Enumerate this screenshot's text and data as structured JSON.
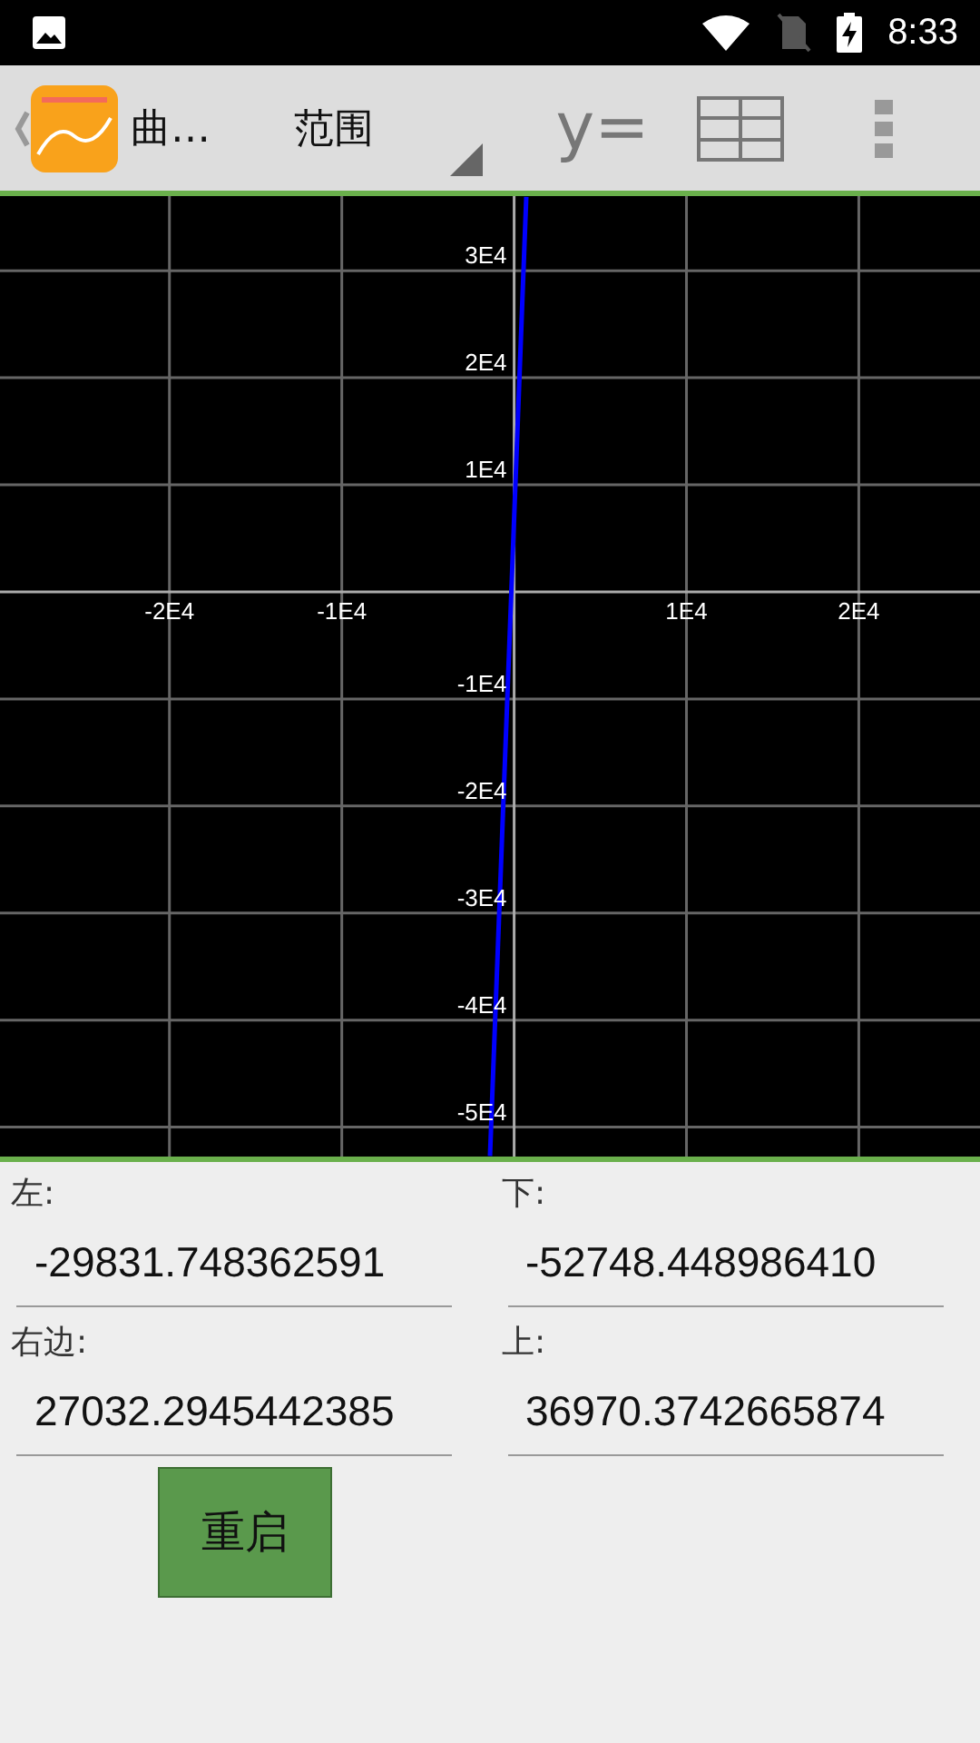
{
  "status_bar": {
    "time": "8:33"
  },
  "toolbar": {
    "title": "曲…",
    "spinner": {
      "label": "范围"
    },
    "equation_action": {
      "label": "y="
    }
  },
  "graph": {
    "chart_data": {
      "type": "line",
      "x": [
        -1400,
        706
      ],
      "grid": true,
      "series": [
        {
          "color": "#0000ff",
          "values": [
            -52700,
            36900
          ]
        }
      ],
      "xlim": [
        -29831.748,
        27032.294
      ],
      "ylim": [
        -52748.449,
        36970.374
      ],
      "xticks": [
        {
          "value": -20000,
          "label": "-2E4"
        },
        {
          "value": -10000,
          "label": "-1E4"
        },
        {
          "value": 10000,
          "label": "1E4"
        },
        {
          "value": 20000,
          "label": "2E4"
        }
      ],
      "yticks": [
        {
          "value": 30000,
          "label": "3E4"
        },
        {
          "value": 20000,
          "label": "2E4"
        },
        {
          "value": 10000,
          "label": "1E4"
        },
        {
          "value": -10000,
          "label": "-1E4"
        },
        {
          "value": -20000,
          "label": "-2E4"
        },
        {
          "value": -30000,
          "label": "-3E4"
        },
        {
          "value": -40000,
          "label": "-4E4"
        },
        {
          "value": -50000,
          "label": "-5E4"
        }
      ]
    }
  },
  "range_fields": [
    {
      "label": "左:",
      "value": "-29831.748362591"
    },
    {
      "label": "下:",
      "value": "-52748.448986410"
    },
    {
      "label": "右边:",
      "value": "27032.2945442385"
    },
    {
      "label": "上:",
      "value": "36970.3742665874"
    }
  ],
  "restart_button": {
    "label": "重启"
  }
}
